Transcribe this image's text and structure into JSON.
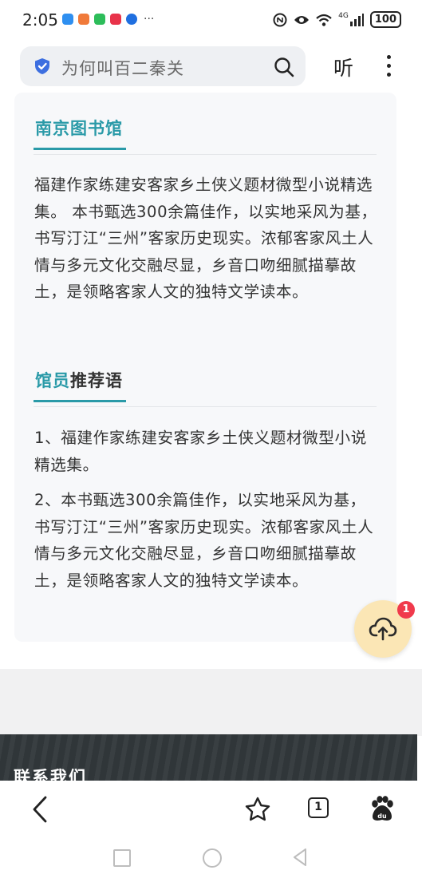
{
  "status_bar": {
    "time": "2:05",
    "more": "···",
    "network": "4G",
    "battery": "100"
  },
  "search": {
    "query": "为何叫百二秦关",
    "listen_label": "听"
  },
  "library_section": {
    "title": "南京图书馆",
    "description": "福建作家练建安客家乡土侠义题材微型小说精选集。 本书甄选300余篇佳作，以实地采风为基，书写汀江“三州”客家历史现实。浓郁客家风土人情与多元文化交融尽显，乡音口吻细腻描摹故土，是领略客家人文的独特文学读本。"
  },
  "recommend_section": {
    "title_highlight": "馆员",
    "title_rest": "推荐语",
    "item1": "1、福建作家练建安客家乡土侠义题材微型小说精选集。",
    "item2": "2、本书甄选300余篇佳作，以实地采风为基，书写汀江“三州”客家历史现实。浓郁客家风土人情与多元文化交融尽显，乡音口吻细腻描摹故土，是领略客家人文的独特文学读本。"
  },
  "upload_badge": "1",
  "footer": {
    "title": "联系我们"
  },
  "toolbar": {
    "tab_count": "1"
  },
  "colors": {
    "accent": "#2a9aa8",
    "badge": "#f03a4c",
    "fab_bg": "#fbe6b5"
  }
}
